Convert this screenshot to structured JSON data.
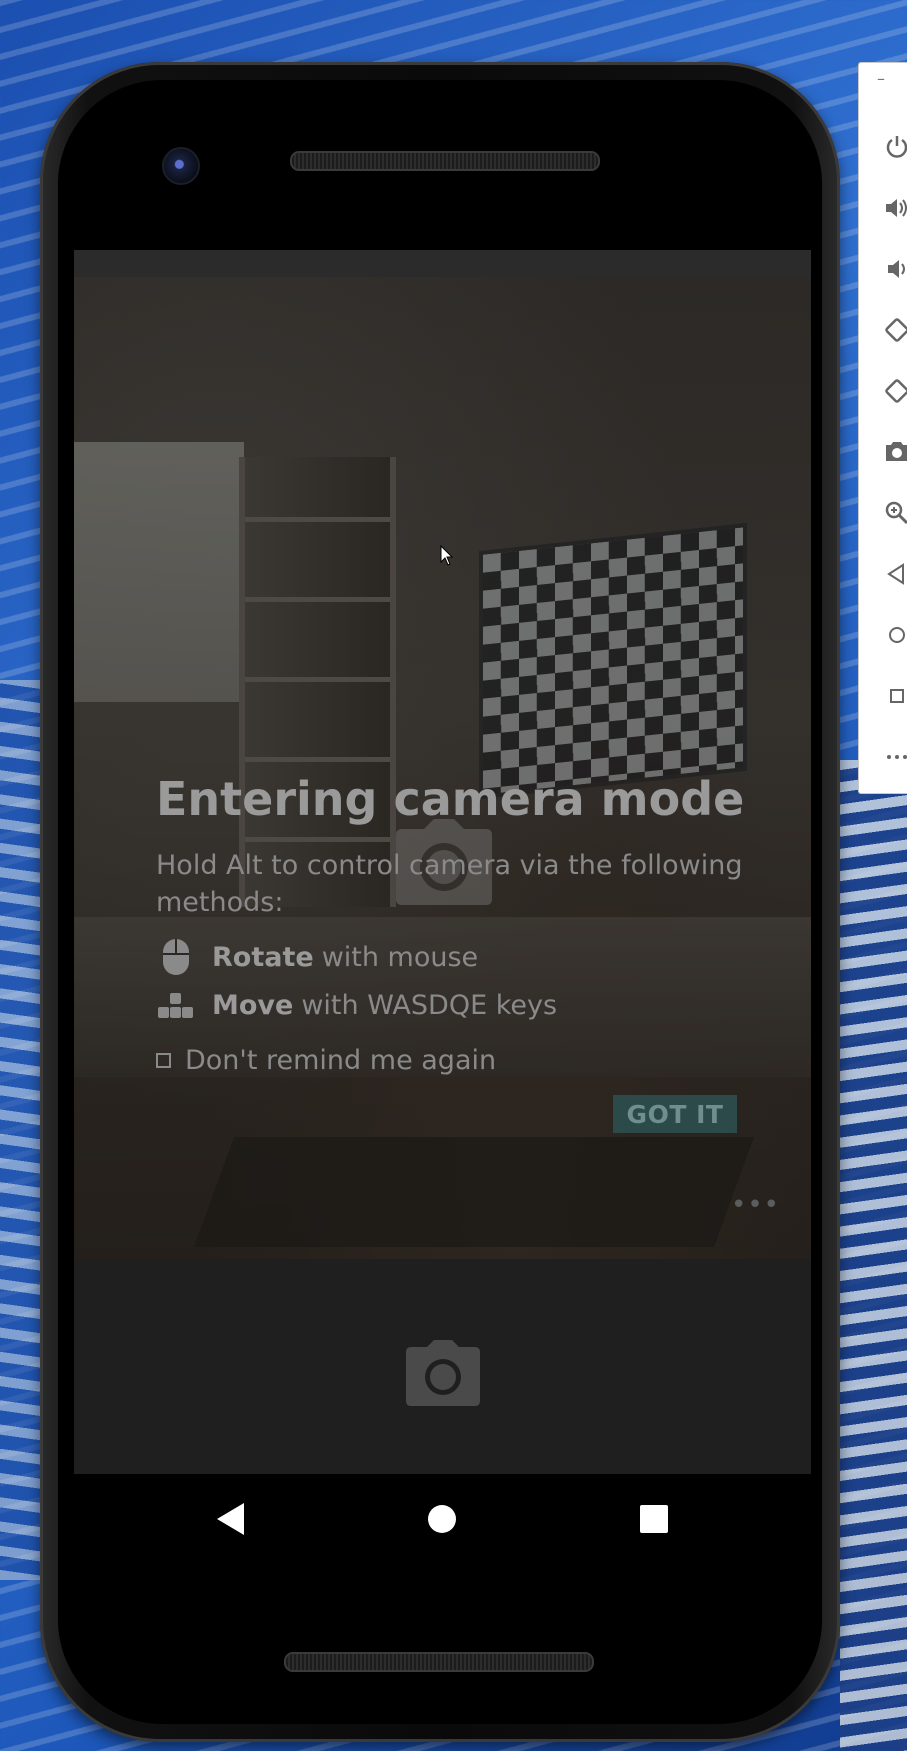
{
  "dialog": {
    "title": "Entering camera mode",
    "description": "Hold Alt to control camera via the following methods:",
    "methods": [
      {
        "icon": "mouse-icon",
        "bold": "Rotate",
        "text": "with mouse"
      },
      {
        "icon": "keys-icon",
        "bold": "Move",
        "text": "with WASDQE keys"
      }
    ],
    "remind_label": "Don't remind me again",
    "remind_checked": false,
    "confirm_label": "GOT IT"
  },
  "camera_feed": {
    "more_label": "•••"
  },
  "emulator_toolbar": {
    "minimize_label": "–",
    "tools": [
      "power-icon",
      "volume-up-icon",
      "volume-down-icon",
      "rotate-left-icon",
      "rotate-right-icon",
      "screenshot-icon",
      "zoom-icon",
      "back-icon",
      "home-icon",
      "overview-icon",
      "more-icon"
    ]
  },
  "colors": {
    "confirm_bg": "#2d4a4a",
    "dialog_text": "#8a8a8a",
    "desktop_blue": "#1b4fb0"
  }
}
